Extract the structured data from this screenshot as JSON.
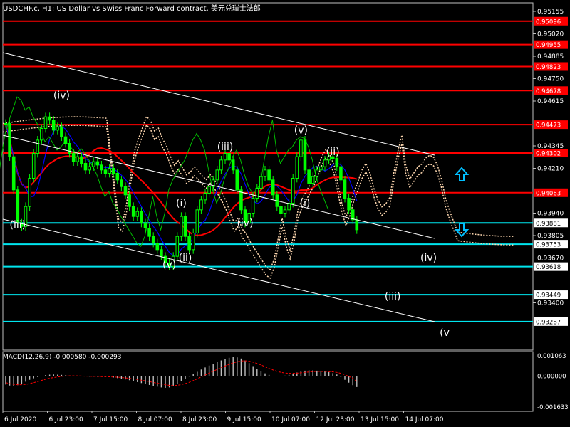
{
  "header": {
    "title": "USDCHF.c, H1:  US Dollar vs Swiss Franc Forward contract, 美元兑瑞士法郎"
  },
  "colors": {
    "background": "#000000",
    "candles": "#00ff00",
    "red_level": "#ff0000",
    "cyan_level": "#00e5ee",
    "channel": "#ffffff",
    "kijun_red": "#ff0000",
    "tenkan_blue": "#0000ff",
    "chikou_green": "#00c000",
    "cloud_dots": "#ffd8b0",
    "macd_hist": "#c0c0c0",
    "macd_signal": "#ff0000",
    "arrow": "#00bfff"
  },
  "chart_data": [
    {
      "type": "line",
      "title": "USDCHF.c, H1",
      "x_tick_labels": [
        "6 Jul 2020",
        "6 Jul 23:00",
        "7 Jul 15:00",
        "8 Jul 07:00",
        "8 Jul 23:00",
        "9 Jul 15:00",
        "10 Jul 07:00",
        "12 Jul 23:00",
        "13 Jul 15:00",
        "14 Jul 07:00"
      ],
      "y_tick_labels": [
        "0.95155",
        "0.95020",
        "0.94885",
        "0.94750",
        "0.94615",
        "0.94345",
        "0.94210",
        "0.93940",
        "0.93805",
        "0.93670",
        "0.93400"
      ],
      "ylim": [
        0.9323,
        0.9518
      ],
      "price_levels": [
        {
          "value": 0.95096,
          "label": "0.95096",
          "color": "red"
        },
        {
          "value": 0.94955,
          "label": "0.94955",
          "color": "red"
        },
        {
          "value": 0.94823,
          "label": "0.94823",
          "color": "red"
        },
        {
          "value": 0.94678,
          "label": "0.94678",
          "color": "red"
        },
        {
          "value": 0.94473,
          "label": "0.94473",
          "color": "red"
        },
        {
          "value": 0.94302,
          "label": "0.94302",
          "color": "red"
        },
        {
          "value": 0.94063,
          "label": "0.94063",
          "color": "red"
        },
        {
          "value": 0.93881,
          "label": "0.93881",
          "color": "cyan"
        },
        {
          "value": 0.93753,
          "label": "0.93753",
          "color": "cyan"
        },
        {
          "value": 0.93618,
          "label": "0.93618",
          "color": "cyan"
        },
        {
          "value": 0.93449,
          "label": "0.93449",
          "color": "cyan"
        },
        {
          "value": 0.93287,
          "label": "0.93287",
          "color": "cyan"
        }
      ],
      "wave_labels": [
        {
          "text": "(iv)",
          "bar": 14,
          "price": 0.9463
        },
        {
          "text": "(iii)",
          "bar": 3,
          "price": 0.9385
        },
        {
          "text": "(iii)",
          "bar": 55,
          "price": 0.9432
        },
        {
          "text": "(v)",
          "bar": 74,
          "price": 0.9442
        },
        {
          "text": "(ii)",
          "bar": 82,
          "price": 0.9429
        },
        {
          "text": "(i)",
          "bar": 44,
          "price": 0.9398
        },
        {
          "text": "(ii)",
          "bar": 45,
          "price": 0.9365
        },
        {
          "text": "(v)",
          "bar": 41,
          "price": 0.9361
        },
        {
          "text": "(iv)",
          "bar": 60,
          "price": 0.9386
        },
        {
          "text": "(i)",
          "bar": 75,
          "price": 0.9398
        },
        {
          "text": "(iv)",
          "bar": 106,
          "price": 0.9365
        },
        {
          "text": "(iii)",
          "bar": 97,
          "price": 0.9342
        },
        {
          "text": "(v",
          "bar": 110,
          "price": 0.932
        }
      ],
      "close_series": [
        0.9448,
        0.9428,
        0.9408,
        0.9388,
        0.9386,
        0.9398,
        0.9415,
        0.943,
        0.9438,
        0.9445,
        0.9452,
        0.945,
        0.9444,
        0.9446,
        0.944,
        0.9436,
        0.943,
        0.9425,
        0.9428,
        0.9424,
        0.942,
        0.9422,
        0.9425,
        0.9423,
        0.942,
        0.9418,
        0.9421,
        0.9418,
        0.9414,
        0.941,
        0.9405,
        0.9398,
        0.9392,
        0.9395,
        0.9388,
        0.9385,
        0.938,
        0.9376,
        0.9372,
        0.9368,
        0.9364,
        0.9362,
        0.9368,
        0.938,
        0.9392,
        0.938,
        0.9372,
        0.9382,
        0.9396,
        0.9402,
        0.9406,
        0.941,
        0.9414,
        0.942,
        0.9426,
        0.943,
        0.9426,
        0.942,
        0.9408,
        0.9396,
        0.9388,
        0.9394,
        0.9403,
        0.9409,
        0.9416,
        0.942,
        0.9414,
        0.9405,
        0.9398,
        0.9394,
        0.9396,
        0.94,
        0.9415,
        0.9428,
        0.9438,
        0.942,
        0.9412,
        0.9416,
        0.942,
        0.9422,
        0.9426,
        0.9428,
        0.9427,
        0.9422,
        0.9414,
        0.9403,
        0.9396,
        0.939,
        0.9384
      ],
      "macd": {
        "label": "MACD(12,26,9) -0.000580 -0.000293",
        "y_tick_labels": [
          "0.001063",
          "0.000000",
          "-0.001633"
        ],
        "ylim": [
          -0.001633,
          0.001063
        ],
        "histogram": [
          -0.00045,
          -0.0005,
          -0.00052,
          -0.00048,
          -0.0004,
          -0.0003,
          -0.0002,
          -0.00012,
          -5e-05,
          1e-05,
          5e-05,
          7e-05,
          8e-05,
          7e-05,
          6e-05,
          4e-05,
          2e-05,
          1e-05,
          0.0,
          -1e-05,
          -2e-05,
          -3e-05,
          -3e-05,
          -4e-05,
          -4e-05,
          -5e-05,
          -6e-05,
          -8e-05,
          -0.00011,
          -0.00014,
          -0.00018,
          -0.00022,
          -0.00027,
          -0.00032,
          -0.00037,
          -0.00042,
          -0.00047,
          -0.00052,
          -0.00056,
          -0.0006,
          -0.00062,
          -0.0006,
          -0.00052,
          -0.0004,
          -0.00026,
          -0.00014,
          -3e-05,
          0.0001,
          0.00022,
          0.00034,
          0.00045,
          0.00055,
          0.00065,
          0.00074,
          0.00082,
          0.0009,
          0.00096,
          0.001,
          0.00098,
          0.00092,
          0.00082,
          0.00068,
          0.00052,
          0.00038,
          0.00025,
          0.00014,
          6e-05,
          1e-05,
          -2e-05,
          -1e-05,
          2e-05,
          6e-05,
          0.00012,
          0.00018,
          0.00024,
          0.00028,
          0.0003,
          0.0003,
          0.00028,
          0.00026,
          0.00024,
          0.0002,
          0.00015,
          8e-05,
          -5e-05,
          -0.0002,
          -0.00035,
          -0.00048,
          -0.00058
        ],
        "signal": [
          -0.00035,
          -0.0004,
          -0.00044,
          -0.00046,
          -0.00046,
          -0.00044,
          -0.0004,
          -0.00035,
          -0.00029,
          -0.00023,
          -0.00017,
          -0.00012,
          -8e-05,
          -5e-05,
          -2e-05,
          0.0,
          1e-05,
          1e-05,
          1e-05,
          0.0,
          -1e-05,
          -1e-05,
          -2e-05,
          -2e-05,
          -3e-05,
          -3e-05,
          -4e-05,
          -5e-05,
          -6e-05,
          -8e-05,
          -0.0001,
          -0.00012,
          -0.00015,
          -0.00018,
          -0.00022,
          -0.00025,
          -0.00029,
          -0.00034,
          -0.00038,
          -0.00042,
          -0.00046,
          -0.00049,
          -0.0005,
          -0.00049,
          -0.00045,
          -0.0004,
          -0.00033,
          -0.00024,
          -0.00015,
          -5e-05,
          5e-05,
          0.00015,
          0.00025,
          0.00035,
          0.00044,
          0.00053,
          0.00061,
          0.00069,
          0.00075,
          0.00079,
          0.0008,
          0.00078,
          0.00073,
          0.00066,
          0.00058,
          0.00049,
          0.0004,
          0.00032,
          0.00025,
          0.00019,
          0.00016,
          0.00014,
          0.00014,
          0.00015,
          0.00017,
          0.00019,
          0.00021,
          0.00023,
          0.00024,
          0.00024,
          0.00024,
          0.00023,
          0.00022,
          0.00019,
          0.00014,
          7e-05,
          -2e-05,
          -0.00012,
          -0.00029
        ]
      }
    }
  ]
}
